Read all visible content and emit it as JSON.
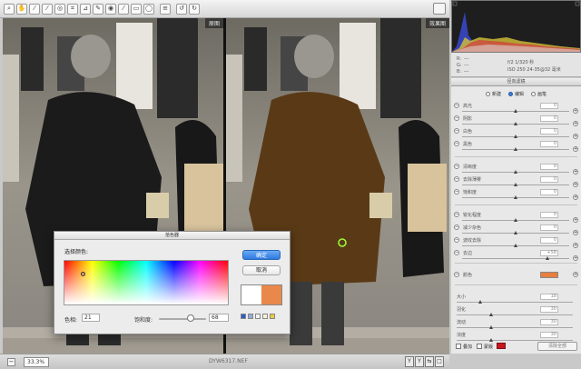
{
  "toolbar": {
    "tools": [
      {
        "icon": "zoom-tool-icon",
        "glyph": "⌕"
      },
      {
        "icon": "hand-tool-icon",
        "glyph": "✋"
      },
      {
        "icon": "white-balance-tool-icon",
        "glyph": "⁄"
      },
      {
        "icon": "color-sampler-tool-icon",
        "glyph": "⁄"
      },
      {
        "icon": "targeted-adjustment-tool-icon",
        "glyph": "◎"
      },
      {
        "icon": "crop-tool-icon",
        "glyph": "⌗"
      },
      {
        "icon": "straighten-tool-icon",
        "glyph": "⊿"
      },
      {
        "icon": "spot-removal-tool-icon",
        "glyph": "✎"
      },
      {
        "icon": "red-eye-tool-icon",
        "glyph": "◉"
      },
      {
        "icon": "adjustment-brush-icon",
        "glyph": "⁄"
      },
      {
        "icon": "graduated-filter-icon",
        "glyph": "▭"
      },
      {
        "icon": "radial-filter-icon",
        "glyph": "◯"
      },
      {
        "icon": "preferences-icon",
        "glyph": "≡"
      },
      {
        "icon": "rotate-ccw-icon",
        "glyph": "↺"
      },
      {
        "icon": "rotate-cw-icon",
        "glyph": "↻"
      }
    ]
  },
  "canvas": {
    "before_label": "原图",
    "after_label": "效果图"
  },
  "statusbar": {
    "zoom_minus": "−",
    "zoom_value": "33.3%",
    "filename": "DYW6317.NEF",
    "view_buttons": [
      "Y",
      "Y",
      "⇆",
      "□"
    ]
  },
  "info": {
    "r": "R:",
    "g": "G:",
    "b": "B:",
    "r_val": "---",
    "g_val": "---",
    "b_val": "---",
    "aperture_shutter": "f/2    1/320 秒",
    "iso_lens": "ISO 250    24-35@32 毫米"
  },
  "panel": {
    "tab_title": "径向滤镜",
    "modes": [
      "新建",
      "编辑",
      "画笔"
    ],
    "active_mode": 1,
    "sliders": [
      {
        "label": "高光",
        "value": "0",
        "pos": 0.5
      },
      {
        "label": "阴影",
        "value": "0",
        "pos": 0.5
      },
      {
        "label": "白色",
        "value": "0",
        "pos": 0.5
      },
      {
        "label": "黑色",
        "value": "0",
        "pos": 0.5
      },
      {
        "label": "清晰度",
        "value": "0",
        "pos": 0.5
      },
      {
        "label": "去除薄雾",
        "value": "0",
        "pos": 0.5
      },
      {
        "label": "饱和度",
        "value": "0",
        "pos": 0.5
      },
      {
        "label": "锐化程度",
        "value": "0",
        "pos": 0.5
      },
      {
        "label": "减少杂色",
        "value": "0",
        "pos": 0.5
      },
      {
        "label": "波纹去除",
        "value": "0",
        "pos": 0.5
      },
      {
        "label": "去边",
        "value": "+58",
        "pos": 0.8
      },
      {
        "label": "大小",
        "value": "18",
        "pos": 0.2
      },
      {
        "label": "羽化",
        "value": "30",
        "pos": 0.3
      },
      {
        "label": "流动",
        "value": "30",
        "pos": 0.3
      },
      {
        "label": "浓度",
        "value": "30",
        "pos": 0.3
      }
    ],
    "color_label": "颜色",
    "color_value": "#e87d3e",
    "auto_mask": "叠加",
    "show_mask": "蒙版",
    "mask_color": "#c8161d",
    "clear_all": "清除全部"
  },
  "dialog": {
    "title": "拾色器",
    "pick_label": "选择颜色:",
    "hue_label": "色相:",
    "hue_value": "21",
    "sat_label": "饱和度:",
    "sat_value": "68",
    "sat_level": 0.68,
    "ok_label": "确定",
    "cancel_label": "取消",
    "preview_before": "#ffffff",
    "preview_after": "#e8884a",
    "swatches": [
      "#2e5cc4",
      "#9aaad6",
      "#f4f4f4",
      "#f6f2d4",
      "#e9c94a"
    ]
  }
}
